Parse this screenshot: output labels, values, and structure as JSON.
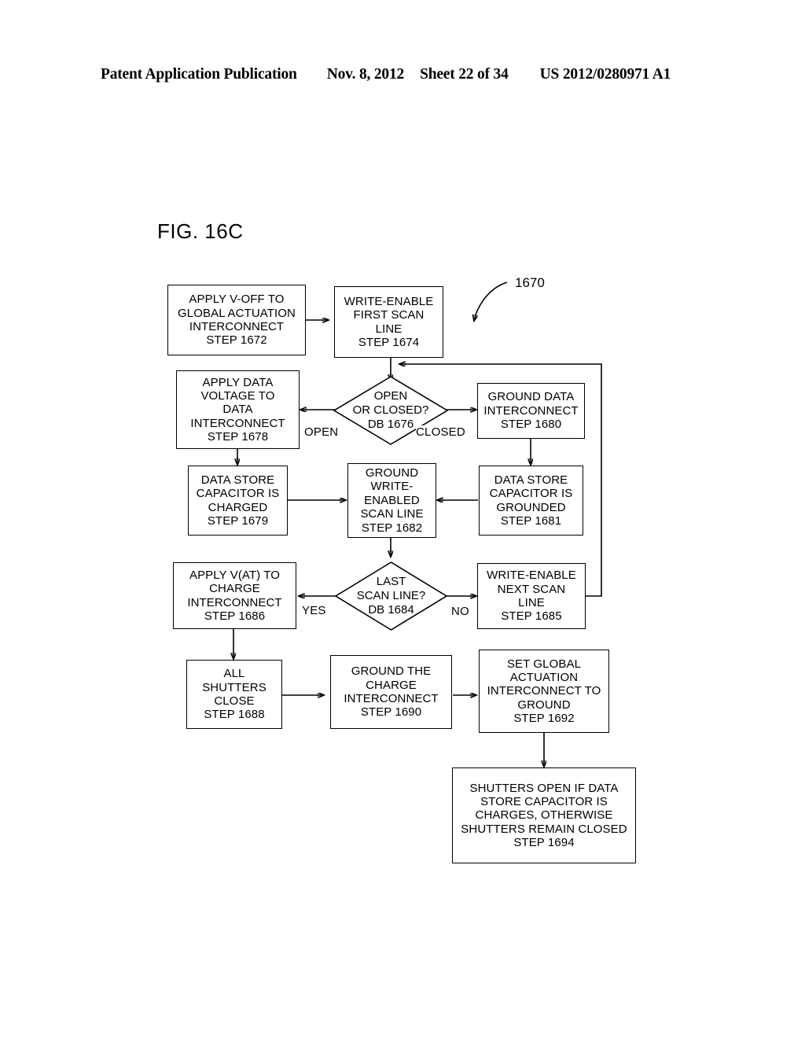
{
  "header": {
    "publication": "Patent Application Publication",
    "date": "Nov. 8, 2012",
    "sheet": "Sheet 22 of 34",
    "number": "US 2012/0280971 A1"
  },
  "figure": {
    "title": "FIG. 16C",
    "reference_numeral": "1670"
  },
  "nodes": {
    "n1672": {
      "lines": [
        "APPLY V-OFF TO",
        "GLOBAL ACTUATION",
        "INTERCONNECT",
        "STEP 1672"
      ]
    },
    "n1674": {
      "lines": [
        "WRITE-ENABLE",
        "FIRST SCAN",
        "LINE",
        "STEP 1674"
      ]
    },
    "n1678": {
      "lines": [
        "APPLY DATA",
        "VOLTAGE TO",
        "DATA",
        "INTERCONNECT",
        "STEP 1678"
      ]
    },
    "n1680": {
      "lines": [
        "GROUND DATA",
        "INTERCONNECT",
        "STEP 1680"
      ]
    },
    "n1679": {
      "lines": [
        "DATA STORE",
        "CAPACITOR IS",
        "CHARGED",
        "STEP 1679"
      ]
    },
    "n1682": {
      "lines": [
        "GROUND",
        "WRITE-",
        "ENABLED",
        "SCAN LINE",
        "STEP 1682"
      ]
    },
    "n1681": {
      "lines": [
        "DATA STORE",
        "CAPACITOR IS",
        "GROUNDED",
        "STEP 1681"
      ]
    },
    "n1686": {
      "lines": [
        "APPLY V(AT) TO",
        "CHARGE",
        "INTERCONNECT",
        "STEP 1686"
      ]
    },
    "n1685": {
      "lines": [
        "WRITE-ENABLE",
        "NEXT SCAN",
        "LINE",
        "STEP 1685"
      ]
    },
    "n1688": {
      "lines": [
        "ALL",
        "SHUTTERS",
        "CLOSE",
        "STEP 1688"
      ]
    },
    "n1690": {
      "lines": [
        "GROUND THE",
        "CHARGE",
        "INTERCONNECT",
        "STEP 1690"
      ]
    },
    "n1692": {
      "lines": [
        "SET GLOBAL",
        "ACTUATION",
        "INTERCONNECT TO",
        "GROUND",
        "STEP 1692"
      ]
    },
    "n1694": {
      "lines": [
        "SHUTTERS OPEN IF DATA",
        "STORE CAPACITOR IS",
        "CHARGES, OTHERWISE",
        "SHUTTERS REMAIN CLOSED",
        "STEP 1694"
      ]
    }
  },
  "decisions": {
    "db1676": {
      "lines": [
        "OPEN",
        "OR CLOSED?",
        "DB 1676"
      ]
    },
    "db1684": {
      "lines": [
        "LAST",
        "SCAN LINE?",
        "DB 1684"
      ]
    }
  },
  "edge_labels": {
    "open": "OPEN",
    "closed": "CLOSED",
    "yes": "YES",
    "no": "NO"
  },
  "colors": {
    "stroke": "#000000",
    "background": "#ffffff"
  }
}
